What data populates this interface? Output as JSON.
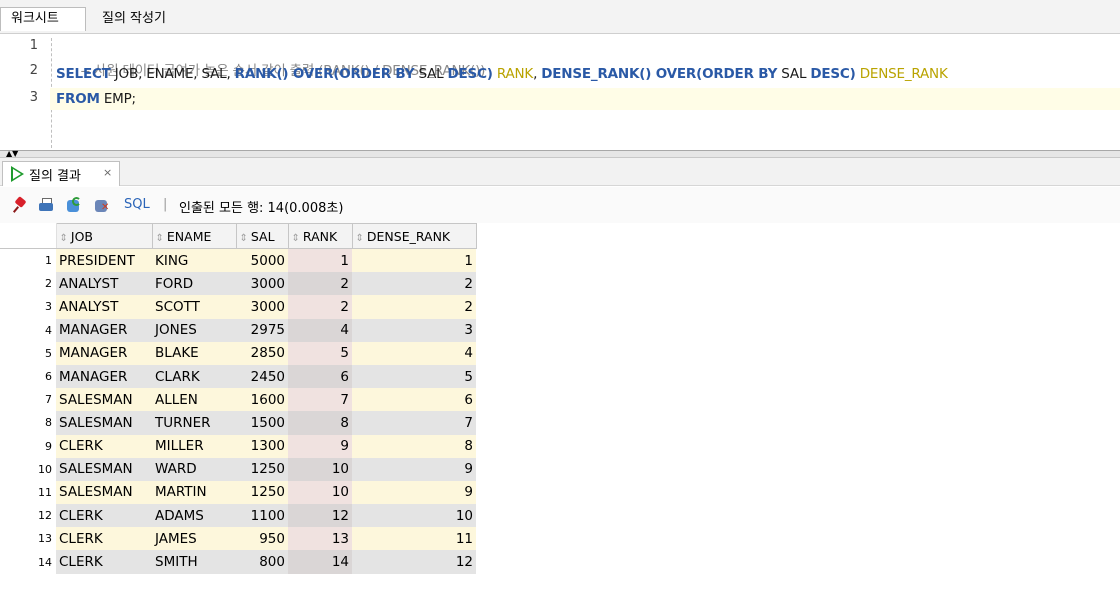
{
  "tabs": {
    "worksheet_label": "워크시트",
    "query_builder_label": "질의 작성기"
  },
  "editor": {
    "line_numbers": [
      "1",
      "2",
      "3"
    ],
    "line1": {
      "comment": "-- 사원 데이터 급여가 높은 순서 같이 출력 (RANK() / DENSE_RANK())"
    },
    "line2": {
      "kw_select": "SELECT",
      "t_job": " JOB",
      "t_cols": ", ENAME, SAL, ",
      "kw_rank": "RANK() OVER(ORDER BY",
      "t_sal1": " SAL ",
      "kw_desc1": "DESC)",
      "a_rank": " RANK",
      "t_comma": ", ",
      "kw_dense": "DENSE_RANK() OVER(ORDER BY",
      "t_sal2": " SAL ",
      "kw_desc2": "DESC)",
      "a_dense": " DENSE_RANK"
    },
    "line3": {
      "kw_from": "FROM",
      "t_emp": " EMP;"
    }
  },
  "result_tab": {
    "label": "질의 결과",
    "close": "×"
  },
  "toolbar": {
    "sql_label": "SQL",
    "separator": "|",
    "status": "인출된 모든 행: 14(0.008초)"
  },
  "icons": [
    "pin-icon",
    "print-icon",
    "refresh-icon",
    "export-icon",
    "run-icon",
    "sort-icon",
    "collapse-arrows-icon"
  ],
  "colors": {
    "keyword": "#2a59a6",
    "alias": "#b9a300",
    "comment": "#8a8a8a",
    "row_odd": "#fdf7dc",
    "row_even": "#e4e4e4",
    "run_green": "#1f9b2e"
  },
  "grid": {
    "sort_glyph": "⇕",
    "columns": [
      "JOB",
      "ENAME",
      "SAL",
      "RANK",
      "DENSE_RANK"
    ],
    "rows": [
      [
        "1",
        "PRESIDENT",
        "KING",
        "5000",
        "1",
        "1"
      ],
      [
        "2",
        "ANALYST",
        "FORD",
        "3000",
        "2",
        "2"
      ],
      [
        "3",
        "ANALYST",
        "SCOTT",
        "3000",
        "2",
        "2"
      ],
      [
        "4",
        "MANAGER",
        "JONES",
        "2975",
        "4",
        "3"
      ],
      [
        "5",
        "MANAGER",
        "BLAKE",
        "2850",
        "5",
        "4"
      ],
      [
        "6",
        "MANAGER",
        "CLARK",
        "2450",
        "6",
        "5"
      ],
      [
        "7",
        "SALESMAN",
        "ALLEN",
        "1600",
        "7",
        "6"
      ],
      [
        "8",
        "SALESMAN",
        "TURNER",
        "1500",
        "8",
        "7"
      ],
      [
        "9",
        "CLERK",
        "MILLER",
        "1300",
        "9",
        "8"
      ],
      [
        "10",
        "SALESMAN",
        "WARD",
        "1250",
        "10",
        "9"
      ],
      [
        "11",
        "SALESMAN",
        "MARTIN",
        "1250",
        "10",
        "9"
      ],
      [
        "12",
        "CLERK",
        "ADAMS",
        "1100",
        "12",
        "10"
      ],
      [
        "13",
        "CLERK",
        "JAMES",
        "950",
        "13",
        "11"
      ],
      [
        "14",
        "CLERK",
        "SMITH",
        "800",
        "14",
        "12"
      ]
    ]
  }
}
